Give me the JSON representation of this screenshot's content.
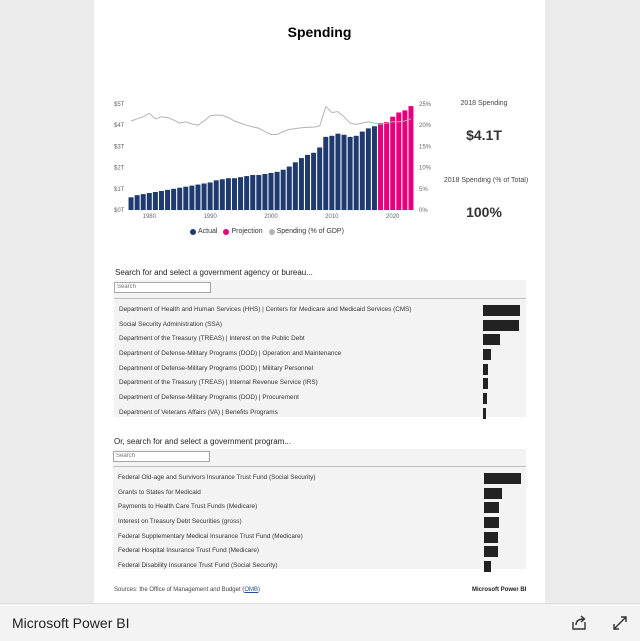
{
  "report": {
    "title": "Spending",
    "kpis": [
      {
        "label": "2018 Spending",
        "value": "$4.1T"
      },
      {
        "label": "2018 Spending (% of Total)",
        "value": "100%"
      }
    ],
    "legend": [
      {
        "label": "Actual",
        "color": "#1f3a6e"
      },
      {
        "label": "Projection",
        "color": "#e6007e"
      },
      {
        "label": "Spending (% of GDP)",
        "color": "#b3b3b3"
      }
    ]
  },
  "chart_data": {
    "type": "bar",
    "x_ticks": [
      "1980",
      "1990",
      "2000",
      "2010",
      "2020"
    ],
    "y_left_ticks": [
      "$0T",
      "$1T",
      "$2T",
      "$3T",
      "$4T",
      "$5T"
    ],
    "y_right_ticks": [
      "0%",
      "5%",
      "10%",
      "15%",
      "20%",
      "25%"
    ],
    "ylim_left": [
      0,
      5
    ],
    "ylim_right": [
      0,
      25
    ],
    "years": [
      1977,
      1978,
      1979,
      1980,
      1981,
      1982,
      1983,
      1984,
      1985,
      1986,
      1987,
      1988,
      1989,
      1990,
      1991,
      1992,
      1993,
      1994,
      1995,
      1996,
      1997,
      1998,
      1999,
      2000,
      2001,
      2002,
      2003,
      2004,
      2005,
      2006,
      2007,
      2008,
      2009,
      2010,
      2011,
      2012,
      2013,
      2014,
      2015,
      2016,
      2017,
      2018,
      2019,
      2020,
      2021,
      2022,
      2023
    ],
    "series": [
      {
        "name": "Actual",
        "values": [
          0.6,
          0.7,
          0.75,
          0.8,
          0.85,
          0.9,
          0.95,
          1.0,
          1.05,
          1.1,
          1.15,
          1.2,
          1.25,
          1.3,
          1.4,
          1.45,
          1.5,
          1.5,
          1.55,
          1.6,
          1.65,
          1.65,
          1.7,
          1.75,
          1.8,
          1.9,
          2.05,
          2.25,
          2.45,
          2.6,
          2.7,
          2.95,
          3.45,
          3.5,
          3.6,
          3.55,
          3.45,
          3.5,
          3.7,
          3.85,
          3.95,
          null,
          null,
          null,
          null,
          null,
          null
        ]
      },
      {
        "name": "Projection",
        "values": [
          null,
          null,
          null,
          null,
          null,
          null,
          null,
          null,
          null,
          null,
          null,
          null,
          null,
          null,
          null,
          null,
          null,
          null,
          null,
          null,
          null,
          null,
          null,
          null,
          null,
          null,
          null,
          null,
          null,
          null,
          null,
          null,
          null,
          null,
          null,
          null,
          null,
          null,
          null,
          null,
          null,
          4.1,
          4.15,
          4.4,
          4.6,
          4.7,
          4.9
        ]
      },
      {
        "name": "Spending (% of GDP)",
        "values": [
          21.0,
          21.5,
          22.0,
          22.8,
          21.5,
          22.0,
          21.8,
          21.2,
          20.5,
          20.8,
          20.3,
          20.0,
          21.0,
          22.2,
          22.4,
          22.3,
          21.8,
          21.0,
          20.5,
          20.0,
          19.6,
          19.3,
          18.5,
          17.8,
          17.8,
          18.5,
          19.0,
          19.2,
          19.4,
          19.5,
          19.5,
          19.8,
          24.4,
          23.0,
          23.2,
          22.0,
          20.5,
          20.2,
          20.5,
          20.8,
          20.5,
          20.2,
          20.5,
          20.8,
          20.8,
          21.0,
          21.5
        ]
      }
    ]
  },
  "agency_slicer": {
    "title": "Search for and select a government agency or bureau...",
    "search_placeholder": "Search",
    "items": [
      {
        "label": "Department of Health and Human Services (HHS) | Centers for Medicare and Medicaid Services (CMS)",
        "value": 100
      },
      {
        "label": "Social Security Administration (SSA)",
        "value": 98
      },
      {
        "label": "Department of the Treasury (TREAS) | Interest on the Public Debt",
        "value": 45
      },
      {
        "label": "Department of Defense-Military Programs (DOD) | Operation and Maintenance",
        "value": 22
      },
      {
        "label": "Department of Defense-Military Programs (DOD) | Military Personnel",
        "value": 14
      },
      {
        "label": "Department of the Treasury (TREAS) | Internal Revenue Service (IRS)",
        "value": 13
      },
      {
        "label": "Department of Defense-Military Programs (DOD) | Procurement",
        "value": 10
      },
      {
        "label": "Department of Veterans Affairs (VA) | Benefits Programs",
        "value": 8
      }
    ]
  },
  "program_slicer": {
    "title": "Or, search for and select a government program...",
    "search_placeholder": "Search",
    "items": [
      {
        "label": "Federal Old-age and Survivors Insurance Trust Fund (Social Security)",
        "value": 100
      },
      {
        "label": "Grants to States for Medicaid",
        "value": 48
      },
      {
        "label": "Payments to Health Care Trust Funds (Medicare)",
        "value": 40
      },
      {
        "label": "Interest on Treasury Debt Securities (gross)",
        "value": 40
      },
      {
        "label": "Federal Supplementary Medical Insurance Trust Fund (Medicare)",
        "value": 38
      },
      {
        "label": "Federal Hospital Insurance Trust Fund (Medicare)",
        "value": 37
      },
      {
        "label": "Federal Disability Insurance Trust Fund (Social Security)",
        "value": 20
      }
    ]
  },
  "source": {
    "prefix": "Sources: the Office of Management and Budget (",
    "link": "OMB",
    "suffix": ")"
  },
  "brand_small": "Microsoft Power BI",
  "footer": {
    "title": "Microsoft Power BI",
    "share_icon": "share-icon",
    "fullscreen_icon": "fullscreen-icon"
  }
}
